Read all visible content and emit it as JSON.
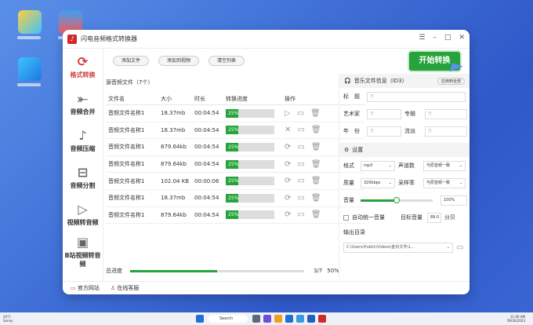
{
  "window": {
    "title": "闪电音频格式转换器",
    "controls": [
      "☰",
      "–",
      "□",
      "✕"
    ]
  },
  "sidebar": {
    "items": [
      {
        "label": "格式转换",
        "icon": "convert-icon",
        "glyph": "⟳",
        "active": true
      },
      {
        "label": "音频合并",
        "icon": "merge-icon",
        "glyph": "⤜",
        "active": false
      },
      {
        "label": "音频压缩",
        "icon": "compress-icon",
        "glyph": "♪",
        "active": false
      },
      {
        "label": "音频分割",
        "icon": "split-icon",
        "glyph": "⊟",
        "active": false
      },
      {
        "label": "视频转音频",
        "icon": "video-to-audio-icon",
        "glyph": "▷",
        "active": false
      },
      {
        "label": "B站视频转音频",
        "icon": "bilibili-icon",
        "glyph": "▣",
        "active": false
      }
    ]
  },
  "toolbar": {
    "add_file": "添加文件",
    "add_folder": "添加到视频",
    "clear": "清空列表",
    "start": "开始转换"
  },
  "list": {
    "header": "源音频文件（7个）",
    "columns": [
      "文件名",
      "大小",
      "时长",
      "转换进度",
      "操作"
    ],
    "rows": [
      {
        "name": "音频文件名称1",
        "size": "18.37mb",
        "duration": "00:04:54",
        "progress": 25,
        "progress_label": "25%"
      },
      {
        "name": "音频文件名称1",
        "size": "18.37mb",
        "duration": "00:04:54",
        "progress": 25,
        "progress_label": "25%"
      },
      {
        "name": "音频文件名称1",
        "size": "879.64kb",
        "duration": "00:04:54",
        "progress": 25,
        "progress_label": "25%"
      },
      {
        "name": "音频文件名称1",
        "size": "879.64kb",
        "duration": "00:04:54",
        "progress": 25,
        "progress_label": "25%"
      },
      {
        "name": "音频文件名称1",
        "size": "102.04 KB",
        "duration": "00:00:06",
        "progress": 25,
        "progress_label": "25%"
      },
      {
        "name": "音频文件名称1",
        "size": "18.37mb",
        "duration": "00:04:54",
        "progress": 25,
        "progress_label": "25%"
      },
      {
        "name": "音频文件名称1",
        "size": "879.64kb",
        "duration": "00:04:54",
        "progress": 25,
        "progress_label": "25%"
      }
    ],
    "total_label": "总进度",
    "total_count": "3/7",
    "total_percent": "50%",
    "total_progress": 50
  },
  "info": {
    "header": "音乐文件信息（ID3）",
    "apply_all": "应用到全部",
    "title_label": "标　题",
    "artist_label": "艺术家",
    "album_label": "专辑",
    "year_label": "年　份",
    "genre_label": "流派",
    "placeholder": "无"
  },
  "settings": {
    "header": "设置",
    "format_label": "格式",
    "format_value": "mp3",
    "channels_label": "声道数",
    "channels_value": "与原音频一致",
    "quality_label": "质量",
    "quality_value": "320kbps",
    "samplerate_label": "采样率",
    "samplerate_value": "与原音频一致",
    "volume_label": "音量",
    "volume_value": "100%",
    "volume_level": 0.5,
    "auto_volume": "自动统一音量",
    "target_volume_label": "目标音量",
    "target_volume_value": "89.0",
    "target_unit": "分贝",
    "output_label": "输出目录",
    "output_path": "C:\\Users\\Public\\Videos\\金舟文件\\1..."
  },
  "bottom": {
    "website": "官方网站",
    "support": "在线客服"
  },
  "taskbar": {
    "weather_temp": "24°C",
    "weather_desc": "Sunny",
    "search": "Search",
    "time": "11:00 AM",
    "date": "09/26/2023"
  }
}
